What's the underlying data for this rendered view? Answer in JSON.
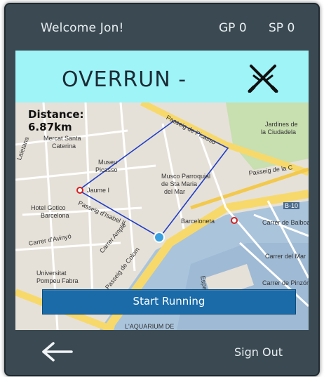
{
  "header": {
    "welcome": "Welcome Jon!",
    "gp": "GP 0",
    "sp": "SP 0"
  },
  "banner": {
    "title": "OVERRUN -",
    "icon": "crossed-swords-icon"
  },
  "map": {
    "distance_label": "Distance:",
    "distance_value": "6.87km",
    "labels": {
      "mercat": "Mercat Santa",
      "caterina": "Caterina",
      "museu": "Museu",
      "picasso": "Picasso",
      "jaume": "Jaume I",
      "hotel": "Hotel Gotico",
      "barcelona": "Barcelona",
      "musico": "Musco Parroquial",
      "sta_maria": "de Sta Maria",
      "del_mar": "del Mar",
      "jardines": "Jardines de",
      "ciudadela": "la Ciudadela",
      "passeig_picasso": "Passeig de Picasso",
      "passeig_ciutat": "Passeig de la C",
      "barceloneta": "Barceloneta",
      "b10": "B-10",
      "balboa": "Carrer de Balboa",
      "carrer_amph": "Carrer d'Avinyó",
      "ampla": "Carrer Ample",
      "universitat": "Universitat",
      "pompeu": "Pompeu Fabra",
      "colom": "Passeig de Colom",
      "aquarium": "L'AQUARIUM DE",
      "laietana": "Laietana",
      "passeig_isabel": "Passeig d'Isabel II",
      "carrer_mar": "Carrer del Mar",
      "carrer_pinzon": "Carrer de Pinzón",
      "espanya": "Espanya"
    }
  },
  "start_button": {
    "label": "Start Running"
  },
  "footer": {
    "back_icon": "back-arrow-icon",
    "signout": "Sign Out"
  },
  "colors": {
    "frame": "#3b4a52",
    "banner": "#9ff4f8",
    "button": "#1a6ba8",
    "route": "#1f3dc8"
  }
}
